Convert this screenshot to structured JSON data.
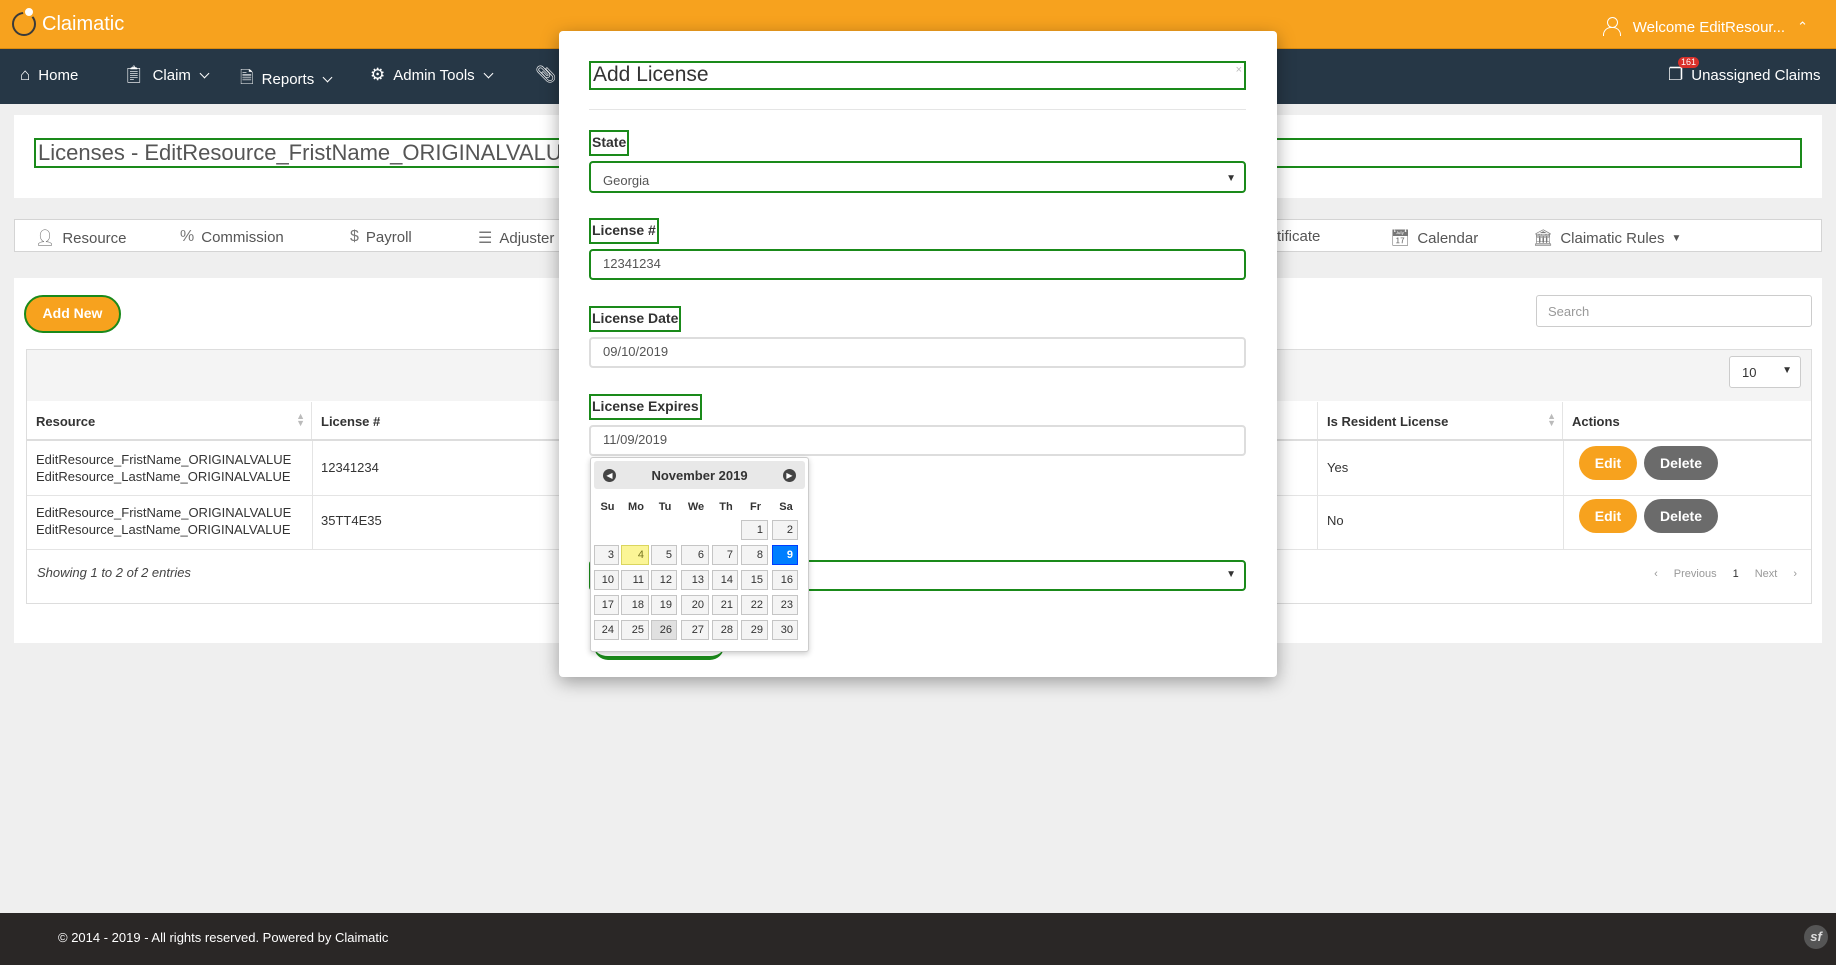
{
  "brand": {
    "name": "Claimatic"
  },
  "header": {
    "welcome": "Welcome EditResour...",
    "caret": "⌃"
  },
  "nav": {
    "home": "Home",
    "claim": "Claim",
    "reports": "Reports",
    "admin_tools": "Admin Tools",
    "unassigned_claims": "Unassigned Claims",
    "unassigned_count": "161"
  },
  "page": {
    "title": "Licenses - EditResource_FristName_ORIGINALVALUE"
  },
  "tabs": [
    "Resource",
    "Commission",
    "Payroll",
    "Adjuster",
    "rtificate",
    "Calendar",
    "Claimatic Rules"
  ],
  "table": {
    "add_new": "Add New",
    "search_placeholder": "Search",
    "per_page": "10",
    "columns": [
      "Resource",
      "License #",
      "Is Resident License",
      "Actions"
    ],
    "rows": [
      {
        "resource_1": "EditResource_FristName_ORIGINALVALUE",
        "resource_2": "EditResource_LastName_ORIGINALVALUE",
        "license": "12341234",
        "resident": "Yes"
      },
      {
        "resource_1": "EditResource_FristName_ORIGINALVALUE",
        "resource_2": "EditResource_LastName_ORIGINALVALUE",
        "license": "35TT4E35",
        "resident": "No"
      }
    ],
    "edit": "Edit",
    "delete": "Delete",
    "showing": "Showing 1 to 2 of 2 entries",
    "previous": "Previous",
    "page": "1",
    "next": "Next"
  },
  "footer": {
    "copyright": "© 2014 - 2019 - All rights reserved. Powered by Claimatic",
    "sf": "sf"
  },
  "modal": {
    "title": "Add License",
    "close": "×",
    "state_label": "State",
    "state_value": "Georgia",
    "license_label": "License #",
    "license_value": "12341234",
    "license_date_label": "License Date",
    "license_date_value": "09/10/2019",
    "license_expires_label": "License Expires",
    "license_expires_value": "11/09/2019"
  },
  "datepicker": {
    "month": "November 2019",
    "dow": [
      "Su",
      "Mo",
      "Tu",
      "We",
      "Th",
      "Fr",
      "Sa"
    ],
    "today": "4",
    "selected": "9",
    "weeks": [
      [
        "",
        "",
        "",
        "",
        "",
        "1",
        "2"
      ],
      [
        "3",
        "4",
        "5",
        "6",
        "7",
        "8",
        "9"
      ],
      [
        "10",
        "11",
        "12",
        "13",
        "14",
        "15",
        "16"
      ],
      [
        "17",
        "18",
        "19",
        "20",
        "21",
        "22",
        "23"
      ],
      [
        "24",
        "25",
        "26",
        "27",
        "28",
        "29",
        "30"
      ]
    ]
  },
  "colors": {
    "accent": "#f7a21e",
    "nav": "#263746",
    "highlight": "#1a8a1a",
    "selected_day": "#007fff"
  }
}
